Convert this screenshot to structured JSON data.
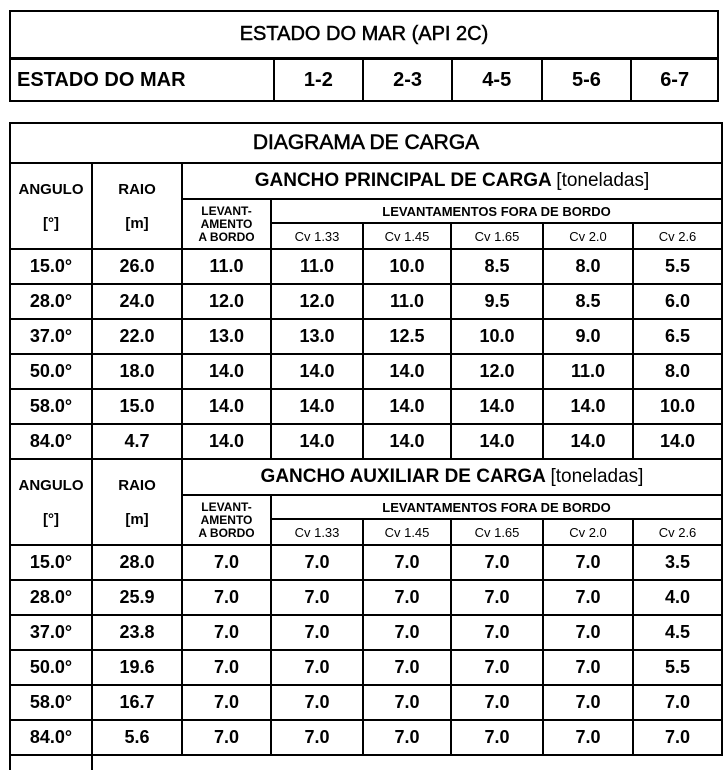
{
  "sea_state": {
    "title": "ESTADO DO MAR  (API 2C)",
    "label": "ESTADO DO MAR",
    "values": [
      "1-2",
      "2-3",
      "4-5",
      "5-6",
      "6-7"
    ]
  },
  "diagram": {
    "title": "DIAGRAMA DE CARGA",
    "headers": {
      "angle": "ANGULO",
      "angle_unit": "[°]",
      "radius": "RAIO",
      "radius_unit": "[m]",
      "onboard": "LEVANT-\nAMENTO\nA BORDO",
      "overboard": "LEVANTAMENTOS FORA DE BORDO",
      "cv": [
        "Cv 1.33",
        "Cv 1.45",
        "Cv 1.65",
        "Cv 2.0",
        "Cv 2.6"
      ]
    },
    "main_hook": {
      "title": "GANCHO PRINCIPAL DE CARGA",
      "unit": "[toneladas]",
      "rows": [
        [
          "15.0°",
          "26.0",
          "11.0",
          "11.0",
          "10.0",
          "8.5",
          "8.0",
          "5.5"
        ],
        [
          "28.0°",
          "24.0",
          "12.0",
          "12.0",
          "11.0",
          "9.5",
          "8.5",
          "6.0"
        ],
        [
          "37.0°",
          "22.0",
          "13.0",
          "13.0",
          "12.5",
          "10.0",
          "9.0",
          "6.5"
        ],
        [
          "50.0°",
          "18.0",
          "14.0",
          "14.0",
          "14.0",
          "12.0",
          "11.0",
          "8.0"
        ],
        [
          "58.0°",
          "15.0",
          "14.0",
          "14.0",
          "14.0",
          "14.0",
          "14.0",
          "10.0"
        ],
        [
          "84.0°",
          "4.7",
          "14.0",
          "14.0",
          "14.0",
          "14.0",
          "14.0",
          "14.0"
        ]
      ]
    },
    "aux_hook": {
      "title": "GANCHO AUXILIAR DE CARGA",
      "unit": "[toneladas]",
      "rows": [
        [
          "15.0°",
          "28.0",
          "7.0",
          "7.0",
          "7.0",
          "7.0",
          "7.0",
          "3.5"
        ],
        [
          "28.0°",
          "25.9",
          "7.0",
          "7.0",
          "7.0",
          "7.0",
          "7.0",
          "4.0"
        ],
        [
          "37.0°",
          "23.8",
          "7.0",
          "7.0",
          "7.0",
          "7.0",
          "7.0",
          "4.5"
        ],
        [
          "50.0°",
          "19.6",
          "7.0",
          "7.0",
          "7.0",
          "7.0",
          "7.0",
          "5.5"
        ],
        [
          "58.0°",
          "16.7",
          "7.0",
          "7.0",
          "7.0",
          "7.0",
          "7.0",
          "7.0"
        ],
        [
          "84.0°",
          "5.6",
          "7.0",
          "7.0",
          "7.0",
          "7.0",
          "7.0",
          "7.0"
        ]
      ]
    }
  }
}
